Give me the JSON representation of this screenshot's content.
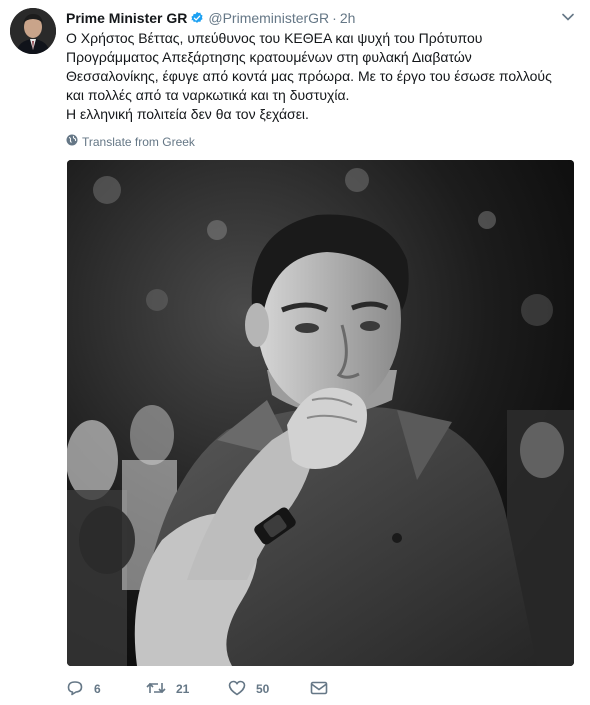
{
  "tweet": {
    "display_name": "Prime Minister GR",
    "handle": "@PrimeministerGR",
    "separator": "·",
    "time": "2h",
    "text_lines": [
      "Ο Χρήστος Βέττας, υπεύθυνος του ΚΕΘΕΑ και ψυχή του Πρότυπου",
      "Προγράμματος Απεξάρτησης κρατουμένων στη φυλακή Διαβατών",
      "Θεσσαλονίκης, έφυγε από κοντά μας πρόωρα. Με το έργο του έσωσε πολλούς",
      "και πολλές από τα ναρκωτικά και τη δυστυχία.",
      "Η ελληνική πολιτεία δεν θα τον ξεχάσει."
    ],
    "translate_label": "Translate from Greek"
  },
  "actions": {
    "reply_count": "6",
    "retweet_count": "21",
    "like_count": "50"
  },
  "icons": {
    "verified": "verified-badge-icon",
    "caret": "chevron-down-icon",
    "globe": "globe-icon",
    "reply": "reply-icon",
    "retweet": "retweet-icon",
    "like": "heart-icon",
    "message": "envelope-icon"
  },
  "colors": {
    "text": "#14171a",
    "secondary": "#657786",
    "verified": "#1da1f2",
    "icon_gray": "#657786"
  }
}
